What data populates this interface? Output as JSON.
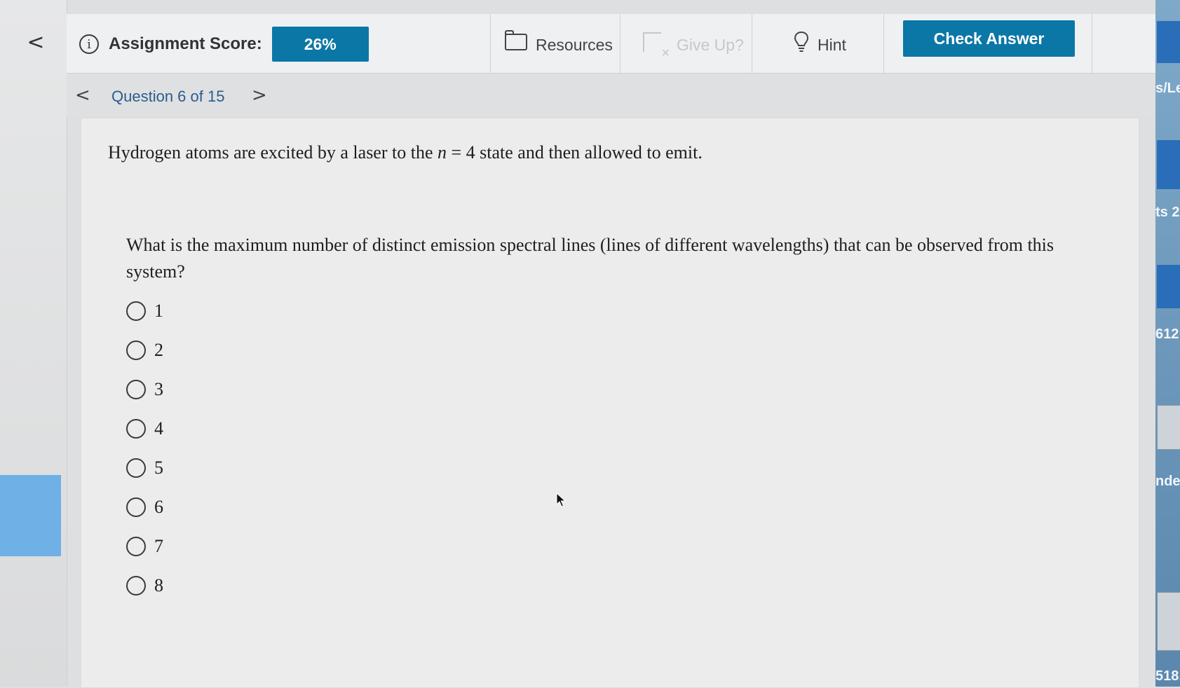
{
  "toolbar": {
    "back_glyph": "<",
    "score_label": "Assignment Score:",
    "score_value": "26%",
    "resources_label": "Resources",
    "giveup_label": "Give Up?",
    "hint_label": "Hint",
    "check_label": "Check Answer"
  },
  "nav": {
    "prev_glyph": "<",
    "next_glyph": ">",
    "question_label": "Question 6 of 15"
  },
  "question": {
    "stem_before": "Hydrogen atoms are excited by a laser to the ",
    "stem_var": "n",
    "stem_after": " = 4 state and then allowed to emit.",
    "prompt": "What is the maximum number of distinct emission spectral lines (lines of different wavelengths) that can be observed from this system?",
    "options": [
      "1",
      "2",
      "3",
      "4",
      "5",
      "6",
      "7",
      "8"
    ]
  },
  "background_window": {
    "fragments": [
      "s/Let",
      "ts 2",
      "612",
      "nde",
      "518."
    ]
  },
  "colors": {
    "accent": "#0b77a6",
    "link": "#2a5d8f"
  }
}
